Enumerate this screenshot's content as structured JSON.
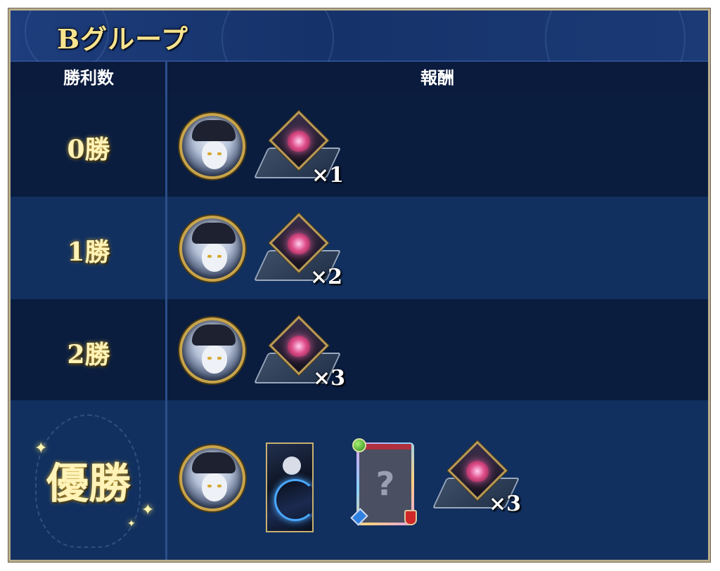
{
  "header": {
    "title": "Bグループ"
  },
  "columns": {
    "wins": "勝利数",
    "rewards": "報酬"
  },
  "rows": [
    {
      "wins": "0勝",
      "rewards": [
        {
          "icon": "character-avatar-icon"
        },
        {
          "icon": "gem-icon",
          "quantity": "×1"
        }
      ]
    },
    {
      "wins": "1勝",
      "rewards": [
        {
          "icon": "character-avatar-icon"
        },
        {
          "icon": "gem-icon",
          "quantity": "×2"
        }
      ]
    },
    {
      "wins": "2勝",
      "rewards": [
        {
          "icon": "character-avatar-icon"
        },
        {
          "icon": "gem-icon",
          "quantity": "×3"
        }
      ]
    },
    {
      "wins": "優勝",
      "rewards": [
        {
          "icon": "character-avatar-icon"
        },
        {
          "icon": "character-card-icon"
        },
        {
          "icon": "mystery-card-icon",
          "symbol": "?"
        },
        {
          "icon": "gem-icon",
          "quantity": "×3"
        }
      ]
    }
  ],
  "colors": {
    "title": "#f7e38f",
    "header_bg": "#1d3d7c",
    "row_dark": "#0a1d3f",
    "row_light": "#11305f",
    "gold_border": "#c8a44a"
  }
}
